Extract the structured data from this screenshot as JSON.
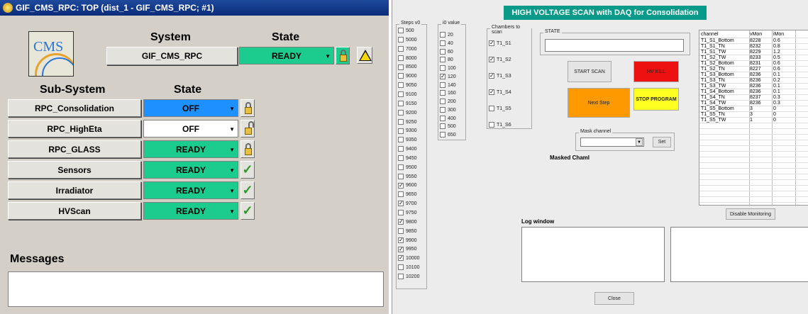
{
  "window_title": "GIF_CMS_RPC: TOP (dist_1 - GIF_CMS_RPC; #1)",
  "logo_text": "CMS",
  "headers": {
    "system": "System",
    "state": "State",
    "subsystem": "Sub-System",
    "state2": "State",
    "messages": "Messages"
  },
  "system": {
    "name": "GIF_CMS_RPC",
    "state": "READY",
    "state_color": "#1ccc8e"
  },
  "subsystems": [
    {
      "name": "RPC_Consolidation",
      "state": "OFF",
      "color": "#1e90ff",
      "indicator": "lock-closed"
    },
    {
      "name": "RPC_HighEta",
      "state": "OFF",
      "color": "#ffffff",
      "indicator": "lock-open"
    },
    {
      "name": "RPC_GLASS",
      "state": "READY",
      "color": "#1ccc8e",
      "indicator": "lock-closed"
    },
    {
      "name": "Sensors",
      "state": "READY",
      "color": "#1ccc8e",
      "indicator": "check"
    },
    {
      "name": "Irradiator",
      "state": "READY",
      "color": "#1ccc8e",
      "indicator": "check"
    },
    {
      "name": "HVScan",
      "state": "READY",
      "color": "#1ccc8e",
      "indicator": "check"
    }
  ],
  "hv": {
    "title": "HIGH VOLTAGE SCAN  with DAQ for Consolidation",
    "steps_label": "Steps v0",
    "steps": [
      {
        "v": "500",
        "on": false
      },
      {
        "v": "5000",
        "on": false
      },
      {
        "v": "7000",
        "on": false
      },
      {
        "v": "8000",
        "on": false
      },
      {
        "v": "8500",
        "on": false
      },
      {
        "v": "9000",
        "on": false
      },
      {
        "v": "9050",
        "on": false
      },
      {
        "v": "9100",
        "on": false
      },
      {
        "v": "9150",
        "on": false
      },
      {
        "v": "9200",
        "on": false
      },
      {
        "v": "9250",
        "on": false
      },
      {
        "v": "9300",
        "on": false
      },
      {
        "v": "9350",
        "on": false
      },
      {
        "v": "9400",
        "on": false
      },
      {
        "v": "9450",
        "on": false
      },
      {
        "v": "9500",
        "on": false
      },
      {
        "v": "9550",
        "on": false
      },
      {
        "v": "9600",
        "on": true
      },
      {
        "v": "9650",
        "on": false
      },
      {
        "v": "9700",
        "on": true
      },
      {
        "v": "9750",
        "on": false
      },
      {
        "v": "9800",
        "on": true
      },
      {
        "v": "9850",
        "on": false
      },
      {
        "v": "9900",
        "on": true
      },
      {
        "v": "9950",
        "on": true
      },
      {
        "v": "10000",
        "on": true
      },
      {
        "v": "10100",
        "on": false
      },
      {
        "v": "10200",
        "on": false
      }
    ],
    "i0_label": "i0 value",
    "i0": [
      {
        "v": "20",
        "on": false
      },
      {
        "v": "40",
        "on": false
      },
      {
        "v": "60",
        "on": false
      },
      {
        "v": "80",
        "on": false
      },
      {
        "v": "100",
        "on": false
      },
      {
        "v": "120",
        "on": true
      },
      {
        "v": "140",
        "on": false
      },
      {
        "v": "160",
        "on": false
      },
      {
        "v": "200",
        "on": false
      },
      {
        "v": "300",
        "on": false
      },
      {
        "v": "400",
        "on": false
      },
      {
        "v": "500",
        "on": false
      },
      {
        "v": "650",
        "on": false
      }
    ],
    "chambers_label": "Chambers to scan",
    "chambers": [
      {
        "v": "T1_S1",
        "on": true
      },
      {
        "v": "T1_S2",
        "on": true
      },
      {
        "v": "T1_S3",
        "on": true
      },
      {
        "v": "T1_S4",
        "on": true
      },
      {
        "v": "T1_S5",
        "on": false
      },
      {
        "v": "T1_S6",
        "on": false
      }
    ],
    "state_label": "STATE",
    "state_value": "",
    "start_scan": "START SCAN",
    "hv_kill": "HV KILL",
    "next_step": "Next Step",
    "stop_program": "STOP PROGRAM",
    "mask_label": "Mask channel",
    "set": "Set",
    "masked_label": "Masked Chaml",
    "disable_monitoring": "Disable Monitoring",
    "log_label": "Log window",
    "close": "Close",
    "colors": {
      "hv_kill": "#ee1111",
      "next_step": "#ff9900",
      "stop_program": "#ffff22",
      "title_bg": "#0a9a8a"
    },
    "table_headers": [
      "channel",
      "vMon",
      "iMon"
    ],
    "table_rows": [
      [
        "T1_S1_Bottom",
        "8228",
        "0.6"
      ],
      [
        "T1_S1_TN",
        "8232",
        "0.8"
      ],
      [
        "T1_S1_TW",
        "8229",
        "1.2"
      ],
      [
        "T1_S2_TW",
        "8233",
        "0.5"
      ],
      [
        "T1_S2_Bottom",
        "8231",
        "0.6"
      ],
      [
        "T1_S2_TN",
        "8227",
        "0.6"
      ],
      [
        "T1_S3_Bottom",
        "8236",
        "0.1"
      ],
      [
        "T1_S3_TN",
        "8236",
        "0.2"
      ],
      [
        "T1_S3_TW",
        "8236",
        "0.1"
      ],
      [
        "T1_S4_Bottom",
        "8236",
        "0.1"
      ],
      [
        "T1_S4_TN",
        "8237",
        "0.3"
      ],
      [
        "T1_S4_TW",
        "8236",
        "0.3"
      ],
      [
        "T1_S5_Bottom",
        "3",
        "0"
      ],
      [
        "T1_S5_TN",
        "3",
        "0"
      ],
      [
        "T1_S5_TW",
        "1",
        "0"
      ]
    ]
  }
}
